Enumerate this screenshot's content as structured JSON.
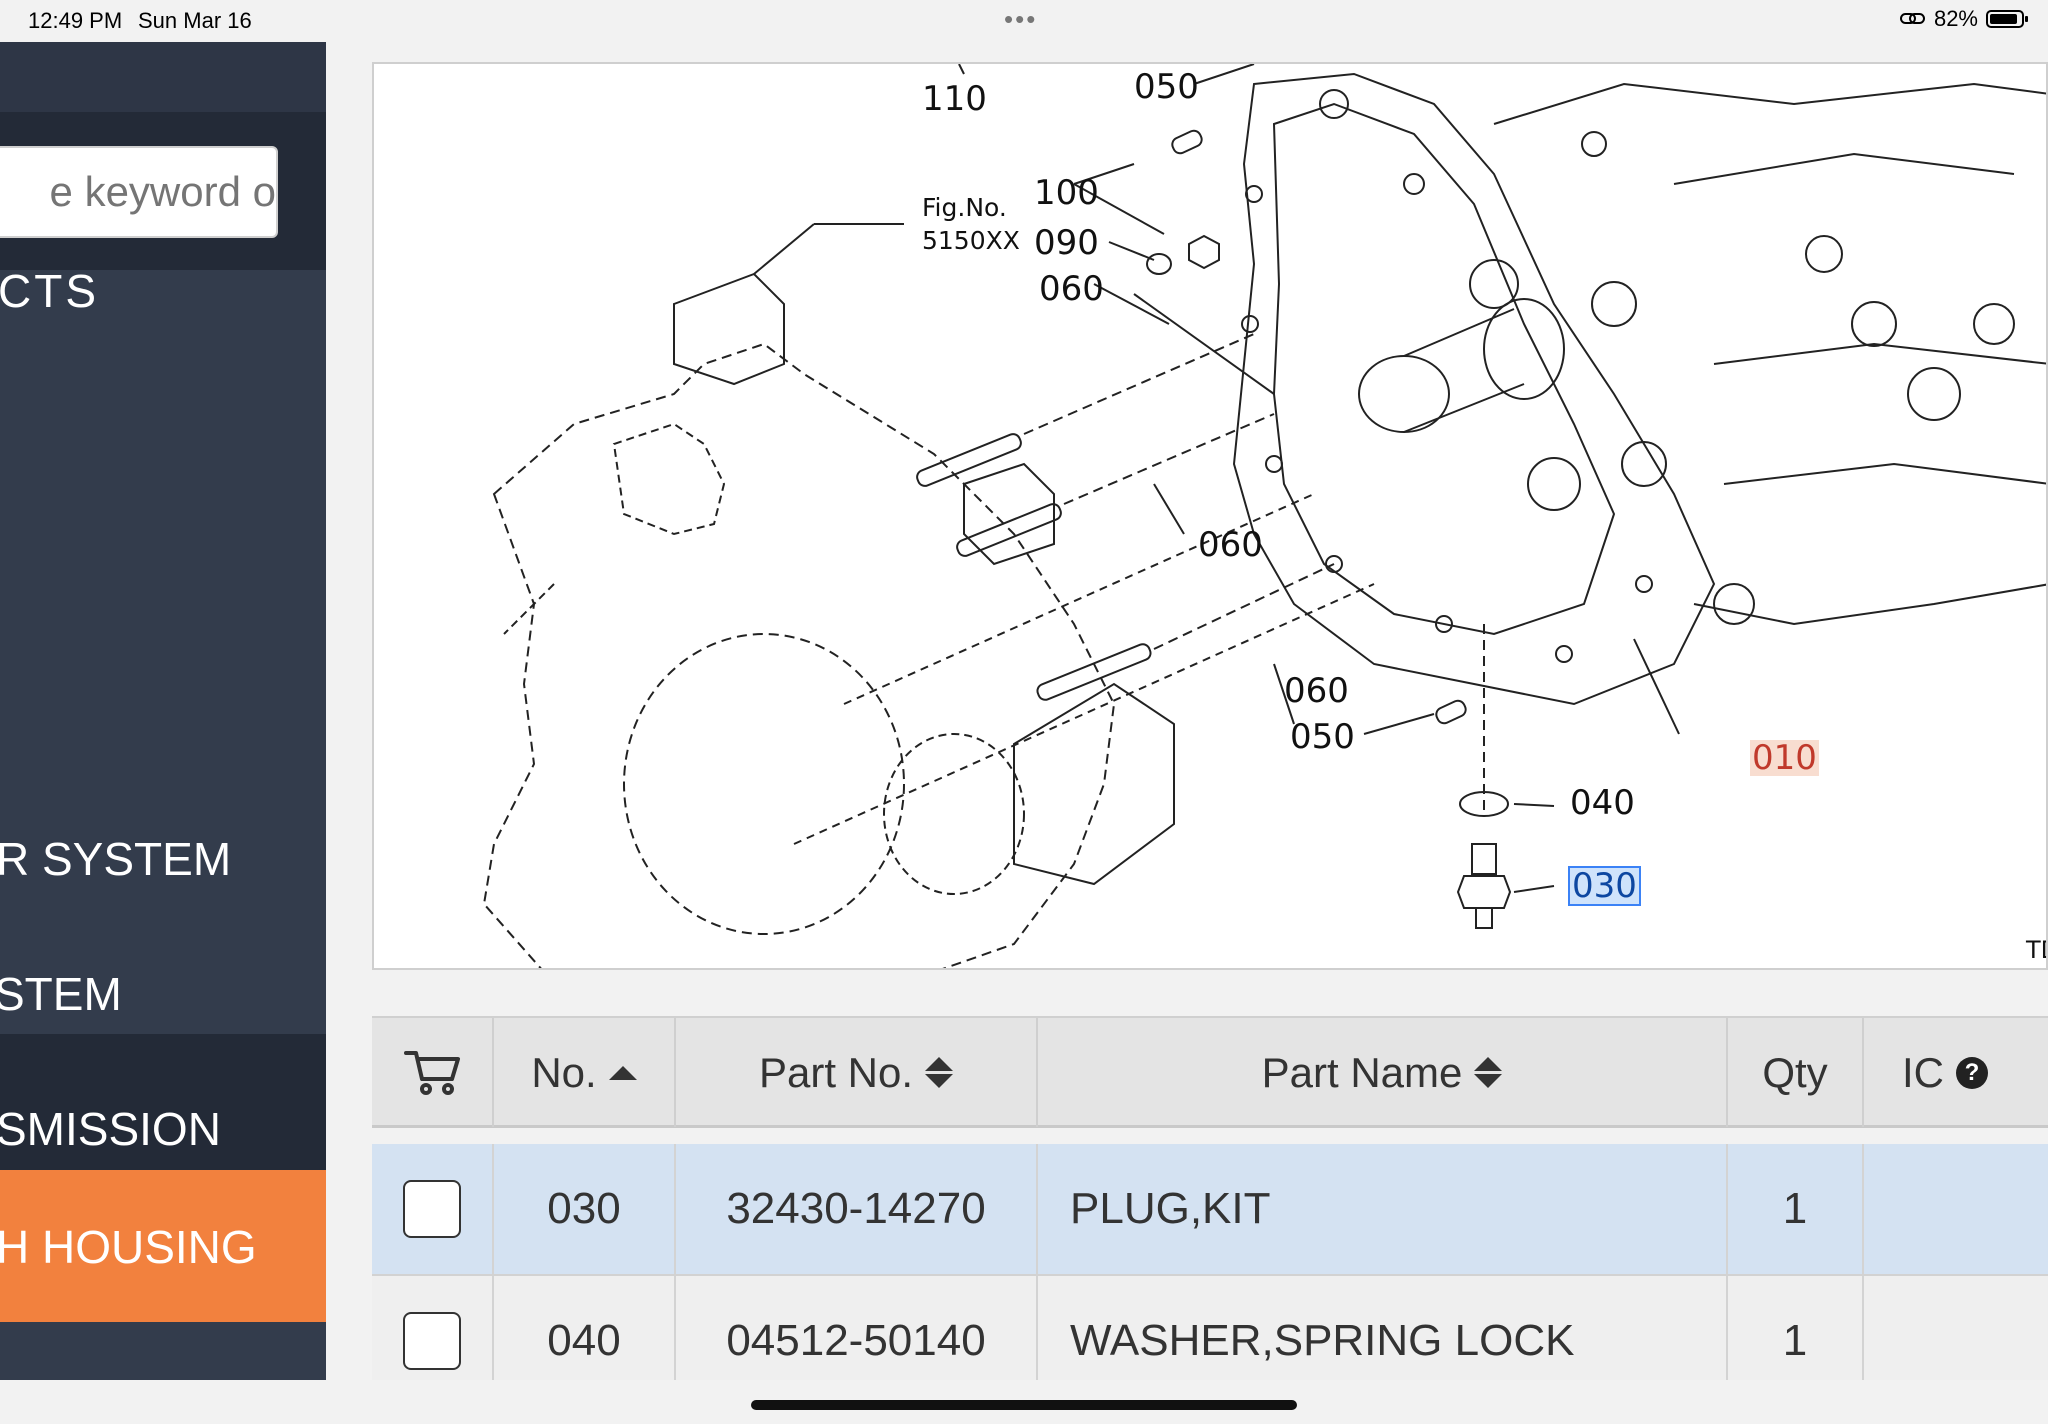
{
  "status_bar": {
    "time": "12:49 PM",
    "date": "Sun Mar 16",
    "dots": "•••",
    "battery_percent": "82%",
    "battery_level": 0.82
  },
  "sidebar": {
    "search_placeholder": "e keyword o",
    "categories": [
      {
        "label": "CTS"
      },
      {
        "label": "R SYSTEM"
      },
      {
        "label": "STEM"
      },
      {
        "label": "SMISSION"
      },
      {
        "label": "H HOUSING"
      }
    ]
  },
  "diagram": {
    "fig_label_1": "Fig.No.",
    "fig_label_2": "5150XX",
    "callouts": {
      "c110": "110",
      "c050_top": "050",
      "c100": "100",
      "c090": "090",
      "c060_a": "060",
      "c060_b": "060",
      "c060_c": "060",
      "c050_bottom": "050",
      "c010": "010",
      "c040": "040",
      "c030": "030",
      "corner_code": "TD"
    }
  },
  "table": {
    "headers": {
      "no": "No.",
      "part_no": "Part No.",
      "part_name": "Part Name",
      "qty": "Qty",
      "ic": "IC"
    },
    "rows": [
      {
        "no": "030",
        "part_no": "32430-14270",
        "part_name": "PLUG,KIT",
        "qty": "1",
        "ic": ""
      },
      {
        "no": "040",
        "part_no": "04512-50140",
        "part_name": "WASHER,SPRING LOCK",
        "qty": "1",
        "ic": ""
      }
    ]
  }
}
